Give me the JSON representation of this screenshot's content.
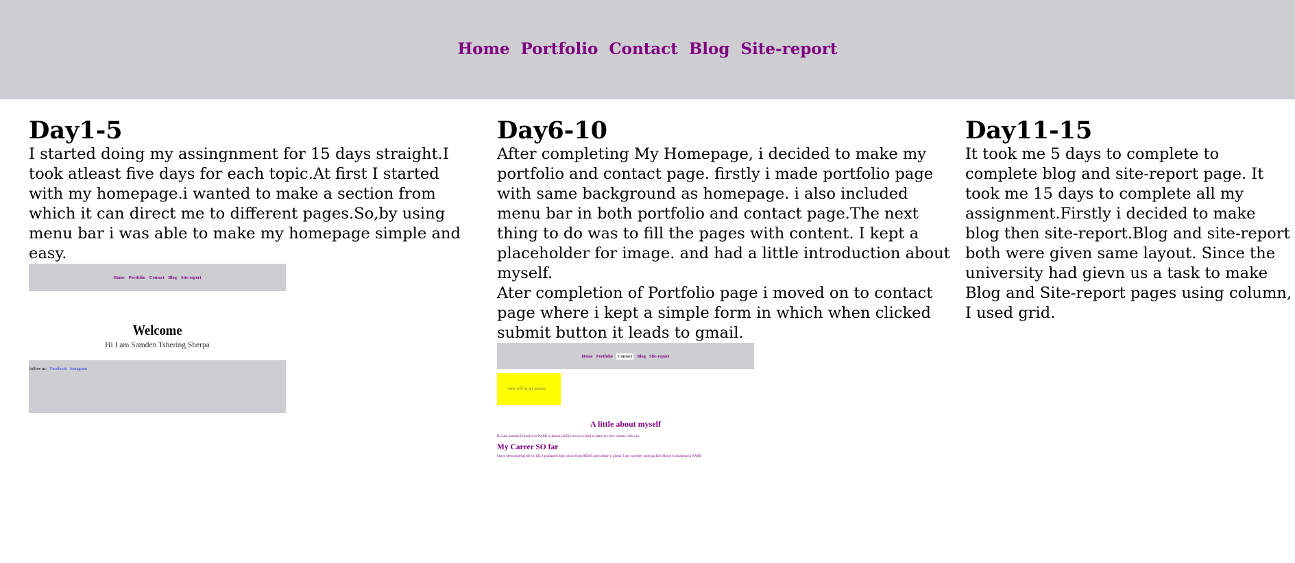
{
  "nav": {
    "items": [
      "Home",
      "Portfolio",
      "Contact",
      "Blog",
      "Site-report"
    ]
  },
  "columns": [
    {
      "title": "Day1-5",
      "text": "I started doing my assingnment for 15 days straight.I took atleast five days for each topic.At first I started with my homepage.i wanted to make a section from which it can direct me to different pages.So,by using menu bar i was able to make my homepage simple and easy."
    },
    {
      "title": "Day6-10",
      "text": "After completing My Homepage, i decided to make my portfolio and contact page. firstly i made portfolio page with same background as homepage. i also included menu bar in both portfolio and contact page.The next thing to do was to fill the pages with content. I kept a placeholder for image. and had a little introduction about myself.",
      "text2": "Ater completion of Portfolio page i moved on to contact page where i kept a simple form in which when clicked submit button it leads to gmail."
    },
    {
      "title": "Day11-15",
      "text": "It took me 5 days to complete to complete blog and site-report page. It took me 15 days to complete all my assignment.Firstly i decided to make blog then site-report.Blog and site-report both were given same layout. Since the university had gievn us a task to make Blog and Site-report pages using column, I used grid."
    }
  ],
  "thumb_home": {
    "nav": [
      "Home",
      "Portfolio",
      "Contact",
      "Blog",
      "Site-report"
    ],
    "welcome": "Welcome",
    "sub": "Hi I am Samden Tshering Sherpa",
    "follow": "follow us:",
    "links": [
      "Facebook",
      "Instagram"
    ]
  },
  "thumb_portfolio": {
    "nav": [
      "Home",
      "Portfolio",
      "Contact",
      "Blog",
      "Site-report"
    ],
    "img_alt": "here will be my picture",
    "heading": "A little about myself",
    "line1": "Hi,I am Samden,I enrolled in NAMI in January,2021.I am so excited to share my first website with you.",
    "career": "My Career SO far",
    "line2": "I have been studying all my life. I graduated high school from HEMS and college is global. I am currently studying BSc(Hons) Computing in NAMI"
  },
  "colors": {
    "header_bg": "#cdcdd2",
    "nav_link": "#800080",
    "thumb_placeholder": "#ffff00"
  }
}
